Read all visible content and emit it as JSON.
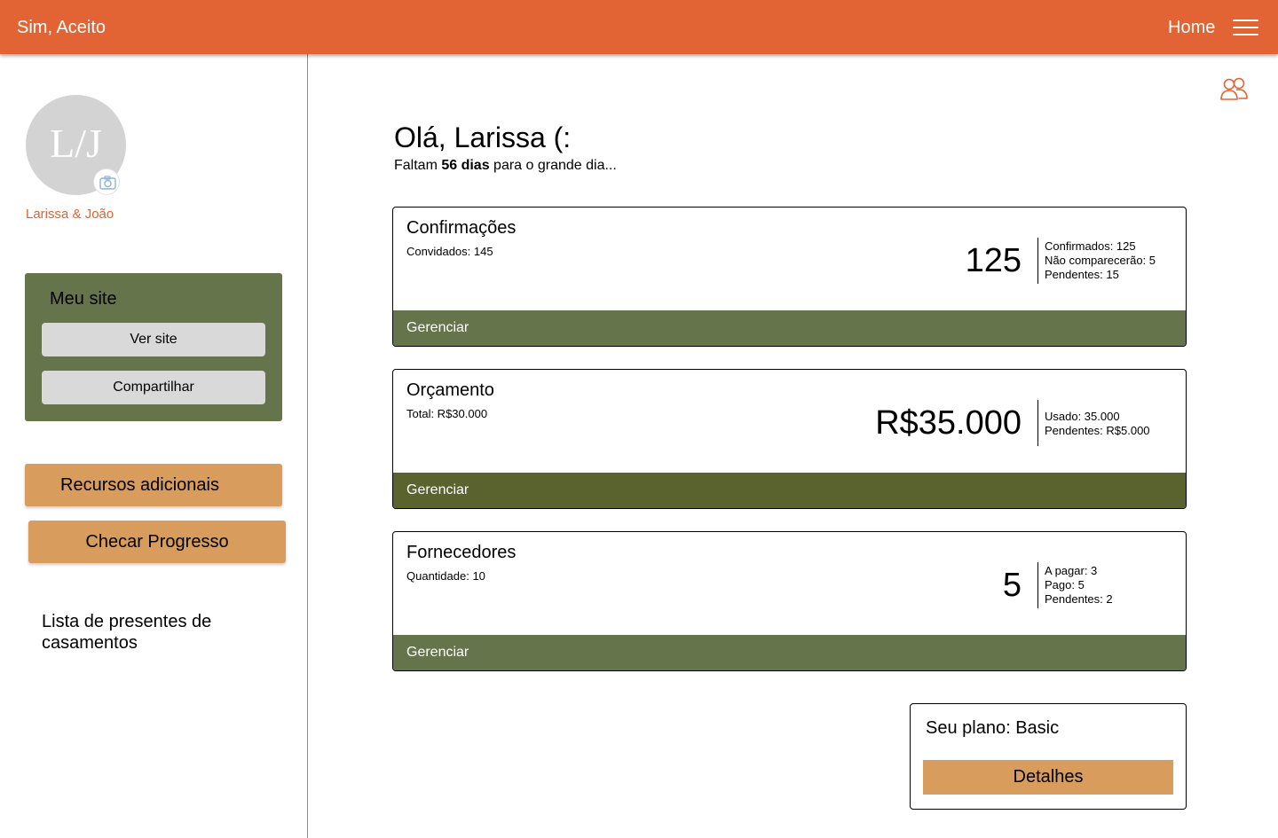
{
  "header": {
    "brand": "Sim, Aceito",
    "home_label": "Home",
    "menu_icon": "hamburger-menu-icon",
    "color": "#e26333"
  },
  "sidebar": {
    "avatar_initials": "L/J",
    "camera_icon": "camera-icon",
    "couple_name": "Larissa & João",
    "my_site": {
      "title": "Meu site",
      "view_label": "Ver site",
      "share_label": "Compartilhar",
      "color": "#66744b"
    },
    "resources_label": "Recursos adicionais",
    "progress_label": "Checar Progresso",
    "gift_list_label": "Lista de presentes de casamentos"
  },
  "main": {
    "people_icon": "people-icon",
    "greeting": "Olá, Larissa (:",
    "countdown": {
      "prefix": "Faltam ",
      "days": "56 dias",
      "suffix": " para o grande dia..."
    },
    "cards": [
      {
        "title": "Confirmações",
        "subtitle": "Convidados: 145",
        "big_value": "125",
        "stats": [
          "Confirmados: 125",
          "Não comparecerão: 5",
          "Pendentes: 15"
        ],
        "action": "Gerenciar"
      },
      {
        "title": "Orçamento",
        "subtitle": "Total: R$30.000",
        "big_value": "R$35.000",
        "stats": [
          "Usado: 35.000",
          "Pendentes: R$5.000"
        ],
        "action": "Gerenciar"
      },
      {
        "title": "Fornecedores",
        "subtitle": "Quantidade: 10",
        "big_value": "5",
        "stats": [
          "A pagar: 3",
          "Pago: 5",
          "Pendentes: 2"
        ],
        "action": "Gerenciar"
      }
    ],
    "plan": {
      "title": "Seu plano: Basic",
      "details_label": "Detalhes"
    }
  },
  "colors": {
    "accent": "#e26333",
    "green": "#66744b",
    "olive": "#5a632e",
    "tan": "#d89c5c"
  }
}
